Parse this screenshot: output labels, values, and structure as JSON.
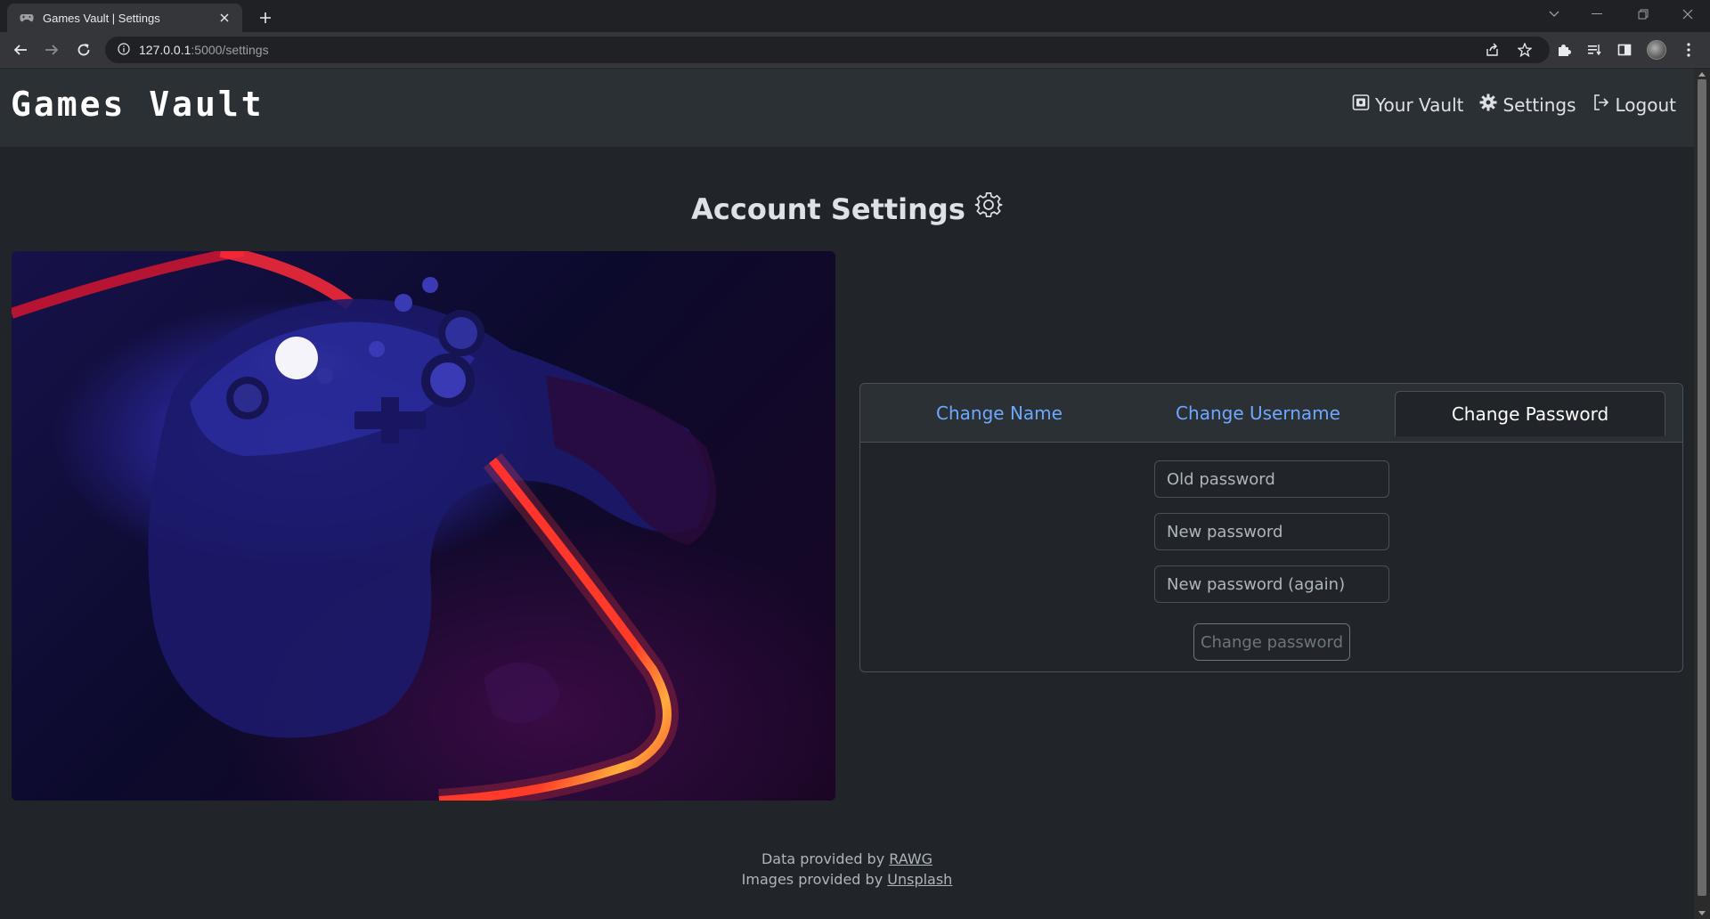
{
  "browser": {
    "tab_title": "Games Vault | Settings",
    "url_host": "127.0.0.1",
    "url_path": ":5000/settings"
  },
  "navbar": {
    "brand": "Games Vault",
    "links": [
      {
        "label": "Your Vault",
        "icon": "vault-icon"
      },
      {
        "label": "Settings",
        "icon": "gear-icon"
      },
      {
        "label": "Logout",
        "icon": "logout-icon"
      }
    ]
  },
  "page": {
    "title": "Account Settings"
  },
  "hero_image": {
    "description_icon": "game-controller-image"
  },
  "settings_card": {
    "tabs": [
      {
        "label": "Change Name",
        "active": false
      },
      {
        "label": "Change Username",
        "active": false
      },
      {
        "label": "Change Password",
        "active": true
      }
    ],
    "fields": [
      {
        "placeholder": "Old password",
        "value": ""
      },
      {
        "placeholder": "New password",
        "value": ""
      },
      {
        "placeholder": "New password (again)",
        "value": ""
      }
    ],
    "submit_label": "Change password"
  },
  "footer": {
    "data_prefix": "Data provided by",
    "data_link": "RAWG",
    "images_prefix": "Images provided by",
    "images_link": "Unsplash"
  },
  "colors": {
    "background": "#212529",
    "navbar": "#2b3035",
    "link": "#6ea8fe",
    "border": "#495057"
  }
}
